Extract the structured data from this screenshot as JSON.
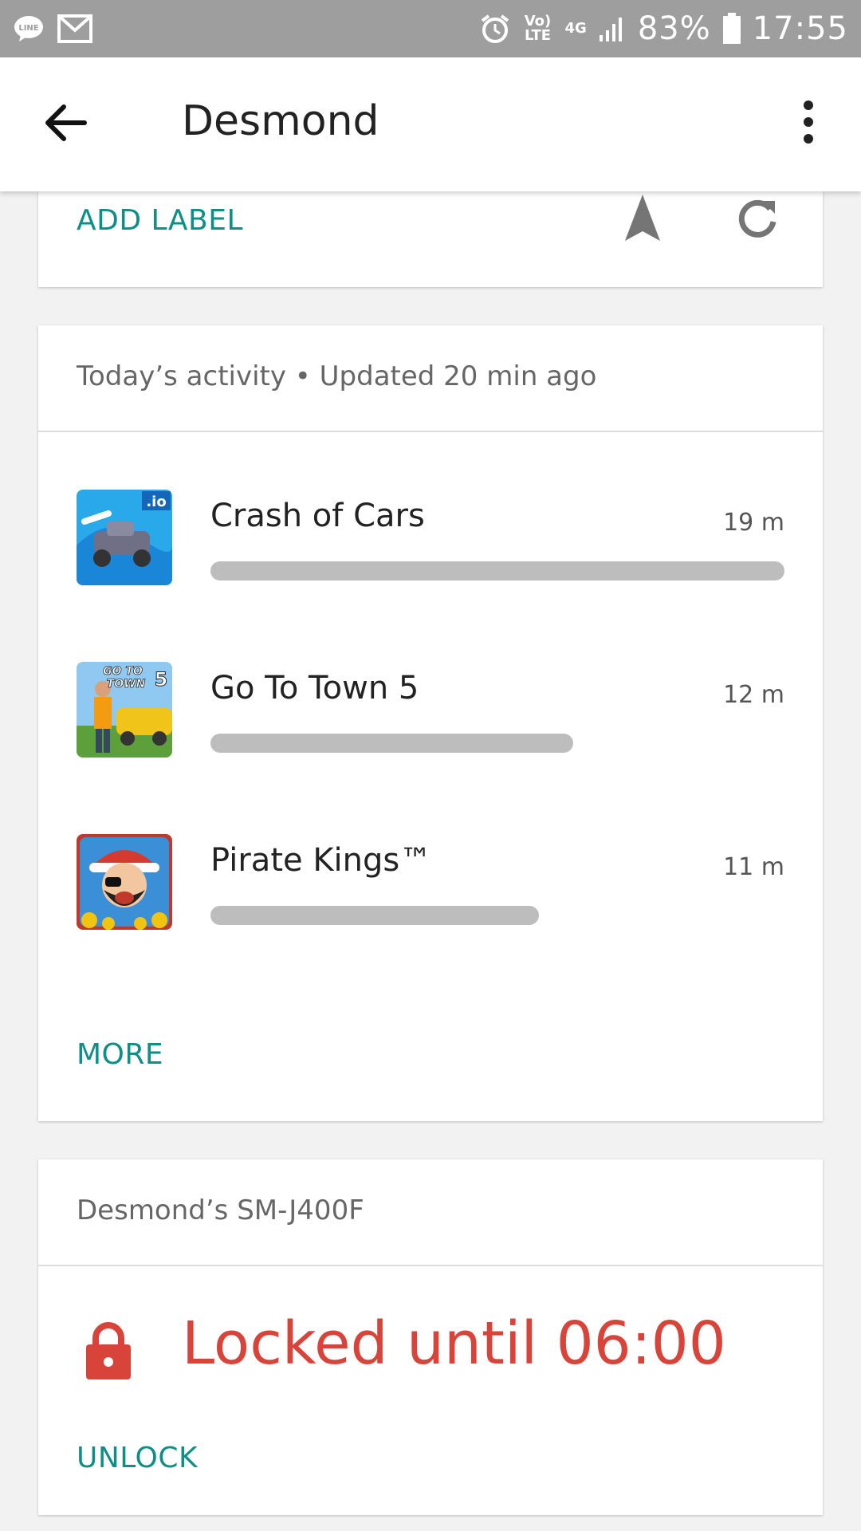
{
  "status_bar": {
    "battery_percent": "83%",
    "time": "17:55",
    "network_volte": "Vo) LTE",
    "network_type": "4G"
  },
  "app_bar": {
    "title": "Desmond"
  },
  "label_card": {
    "add_label": "ADD LABEL"
  },
  "activity_card": {
    "header": "Today’s activity • Updated 20 min ago",
    "apps": [
      {
        "name": "Crash of Cars",
        "time": "19 m",
        "usage_fraction": 1.0
      },
      {
        "name": "Go To Town 5",
        "time": "12 m",
        "usage_fraction": 0.632
      },
      {
        "name": "Pirate Kings™",
        "time": "11 m",
        "usage_fraction": 0.572
      }
    ],
    "more_label": "MORE"
  },
  "device_card": {
    "header": "Desmond’s SM-J400F",
    "locked_text": "Locked until 06:00",
    "unlock_label": "UNLOCK"
  },
  "colors": {
    "accent": "#0b8f86",
    "locked_red": "#d9443a",
    "bar_gray": "#bdbdbd",
    "status_bar": "#9e9e9e"
  }
}
